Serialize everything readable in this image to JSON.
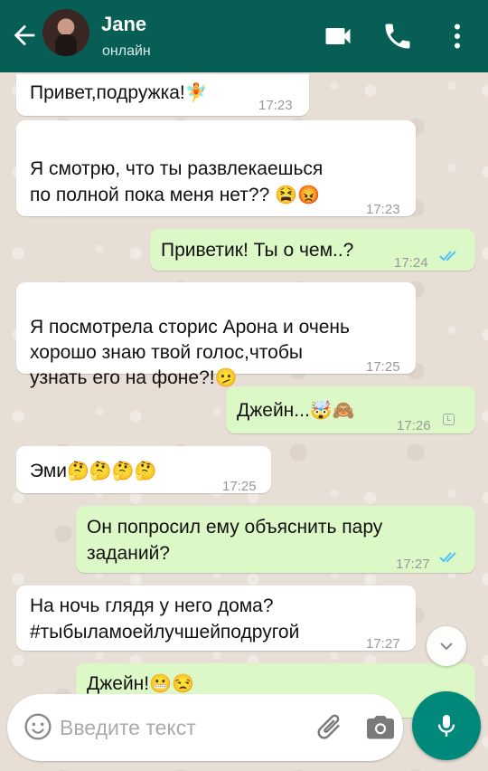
{
  "header": {
    "contact_name": "Jane",
    "status": "онлайн"
  },
  "messages": [
    {
      "dir": "in",
      "text": "Привет,подружка!",
      "emoji": "🧚",
      "time": "17:23"
    },
    {
      "dir": "in",
      "text": "Я смотрю, что ты развлекаешься\nпо полной пока меня нет??",
      "emoji": "😫😡",
      "time": "17:23"
    },
    {
      "dir": "out",
      "text": "Приветик! Ты о чем..?",
      "time": "17:24",
      "status": "read"
    },
    {
      "dir": "in",
      "text": "Я посмотрела сторис Арона и очень\nхорошо знаю твой голос,чтобы\nузнать его на фоне?!",
      "emoji": "🫤",
      "time": "17:25"
    },
    {
      "dir": "out",
      "text": "Джейн...",
      "emoji": "🤯🙈",
      "time": "17:26",
      "status": "pending"
    },
    {
      "dir": "in",
      "text": "Эми",
      "emoji": "🤔🤔🤔🤔",
      "time": "17:25"
    },
    {
      "dir": "out",
      "text": "Он попросил ему объяснить пару\nзаданий?",
      "time": "17:27",
      "status": "read"
    },
    {
      "dir": "in",
      "text": "На ночь глядя у него дома?\n#тыбыламоейлучшейподругой",
      "time": "17:27"
    },
    {
      "dir": "out",
      "text": "Джейн!",
      "emoji": "😬😒",
      "time": ""
    }
  ],
  "input": {
    "placeholder": "Введите текст"
  },
  "icons": {
    "back": "arrow-left-icon",
    "video": "video-camera-icon",
    "call": "phone-icon",
    "more": "more-vertical-icon",
    "emoji": "smiley-icon",
    "attach": "paperclip-icon",
    "camera": "camera-icon",
    "mic": "microphone-icon",
    "scroll": "chevron-down-icon"
  },
  "colors": {
    "header": "#075e54",
    "incoming": "#ffffff",
    "outgoing": "#dcf8c6",
    "read_tick": "#4fc3f7",
    "mic_button": "#00897b"
  }
}
